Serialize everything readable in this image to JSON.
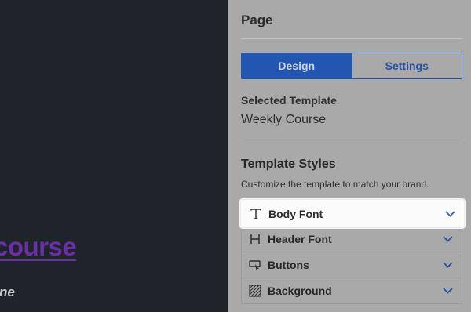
{
  "canvas": {
    "course_text": "course",
    "tail_text": "ne"
  },
  "panel": {
    "title": "Page",
    "tabs": [
      {
        "label": "Design",
        "active": true
      },
      {
        "label": "Settings",
        "active": false
      }
    ],
    "selected_template_label": "Selected Template",
    "selected_template_value": "Weekly Course",
    "template_styles_title": "Template Styles",
    "template_styles_desc": "Customize the template to match your brand.",
    "accordion": [
      {
        "label": "Body Font",
        "icon": "text-t-icon",
        "highlighted": true
      },
      {
        "label": "Header Font",
        "icon": "header-h-icon"
      },
      {
        "label": "Buttons",
        "icon": "button-cursor-icon"
      },
      {
        "label": "Background",
        "icon": "hatch-pattern-icon"
      }
    ]
  },
  "colors": {
    "accent": "#2356b0",
    "link_purple": "#6a2fa5",
    "panel_bg": "#a9a9a9",
    "canvas_bg": "#1f242b"
  }
}
